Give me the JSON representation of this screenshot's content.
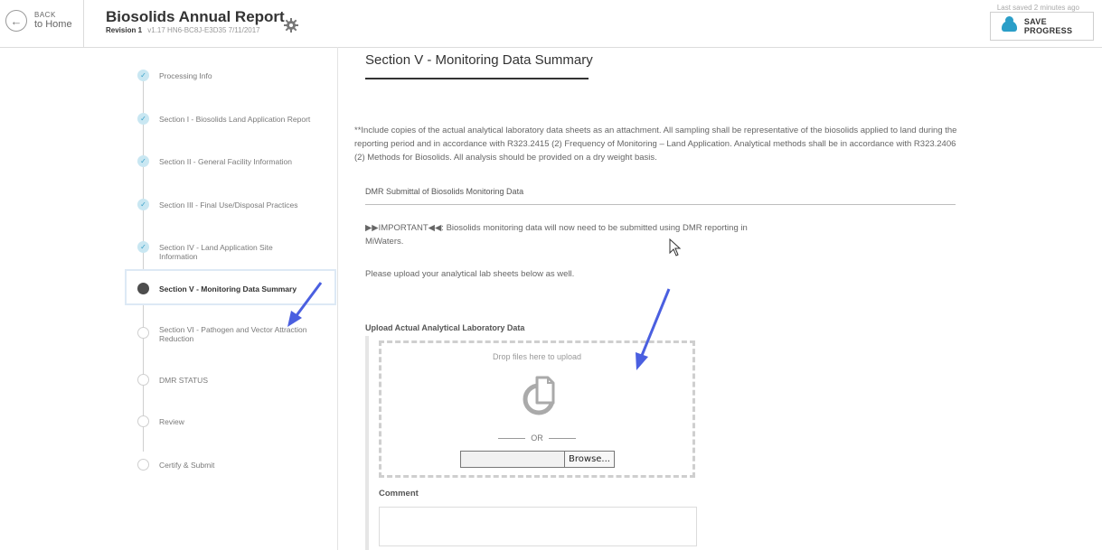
{
  "header": {
    "back_small": "BACK",
    "back_big": "to Home",
    "title": "Biosolids Annual Report",
    "revision": "Revision 1",
    "meta": "v1.17   HN6-BC8J-E3D35   7/11/2017",
    "last_saved": "Last saved 2 minutes ago",
    "save_label": "SAVE PROGRESS"
  },
  "nav": {
    "steps": [
      {
        "label": "Processing Info",
        "state": "done"
      },
      {
        "label": "Section I - Biosolids Land Application Report",
        "state": "done"
      },
      {
        "label": "Section II - General Facility Information",
        "state": "done"
      },
      {
        "label": "Section III - Final Use/Disposal Practices",
        "state": "done"
      },
      {
        "label": "Section IV - Land Application Site Information",
        "state": "done"
      },
      {
        "label": "Section V - Monitoring Data Summary",
        "state": "active"
      },
      {
        "label": "Section VI - Pathogen and Vector Attraction Reduction",
        "state": "todo"
      },
      {
        "label": "DMR STATUS",
        "state": "todo"
      },
      {
        "label": "Review",
        "state": "todo"
      },
      {
        "label": "Certify & Submit",
        "state": "todo"
      }
    ]
  },
  "main": {
    "section_title": "Section V - Monitoring Data Summary",
    "intro": "**Include copies of the actual analytical laboratory data sheets as an attachment. All sampling shall be representative of the biosolids applied to land during the reporting period and in accordance with R323.2415 (2) Frequency of Monitoring – Land Application. Analytical methods shall be in accordance with R323.2406 (2) Methods for Biosolids. All analysis should be provided on a dry weight basis.",
    "dmr_heading": "DMR Submittal of Biosolids Monitoring Data",
    "important": "▶▶IMPORTANT◀◀: Biosolids monitoring data will now need to be submitted using DMR reporting in MiWaters.",
    "upload_note": "Please upload your analytical lab sheets below as well.",
    "upload_title": "Upload Actual Analytical Laboratory Data",
    "drop_text": "Drop files here to upload",
    "or_text": "OR",
    "browse_label": "Browse...",
    "comment_label": "Comment"
  },
  "colors": {
    "accent": "#2a9ec8",
    "done_dot": "#c9e7f2",
    "active_dot": "#4d4d4d",
    "annotation_arrow": "#4a5fe0"
  }
}
